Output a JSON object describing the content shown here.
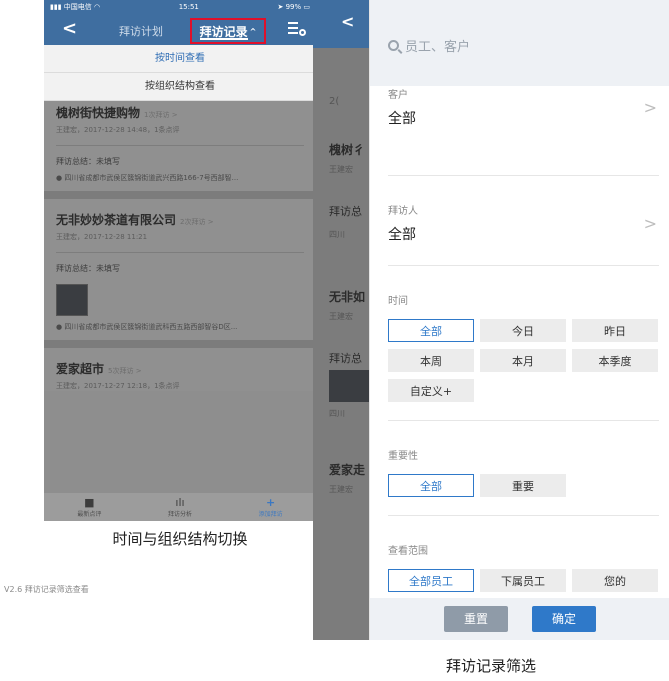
{
  "left_phone": {
    "status": {
      "carrier": "中国电信",
      "time": "15:51",
      "battery": "99%"
    },
    "nav": {
      "tab_plan": "拜访计划",
      "tab_record": "拜访记录"
    },
    "dropdown": [
      "按时间查看",
      "按组织结构查看"
    ],
    "cards": [
      {
        "title": "槐树街快捷购物",
        "count": "1次拜访 >",
        "meta": "王建宏，2017-12-28 14:48，1条点评",
        "summary": "拜访总结：未填写",
        "location": "四川省成都市武侯区簇锦街道武兴西路166-7号西部智..."
      },
      {
        "title": "无非妙妙茶道有限公司",
        "count": "2次拜访 >",
        "meta": "王建宏，2017-12-28 11:21",
        "summary": "拜访总结：未填写",
        "location": "四川省成都市武侯区簇锦街道武科西五路西部智谷D区..."
      },
      {
        "title": "爱家超市",
        "count": "5次拜访 >",
        "meta": "王建宏，2017-12-27 12:18，1条点评"
      }
    ],
    "tabbar": [
      "最新点评",
      "拜访分析",
      "添加拜访"
    ]
  },
  "caption_left": "时间与组织结构切换",
  "version_note": "V2.6 拜访记录筛选查看",
  "right_bg": {
    "nav_back": "<",
    "fragments": [
      "2(",
      "槐树彳",
      "王建宏",
      "拜访总",
      "四川",
      "无非如",
      "王建宏",
      "拜访总",
      "四川",
      "爱家走",
      "王建宏"
    ]
  },
  "filter_panel": {
    "search_placeholder": "员工、客户",
    "customer": {
      "label": "客户",
      "value": "全部"
    },
    "visitor": {
      "label": "拜访人",
      "value": "全部"
    },
    "time": {
      "label": "时间",
      "options": [
        "全部",
        "今日",
        "昨日",
        "本周",
        "本月",
        "本季度",
        "自定义+"
      ],
      "selected": "全部"
    },
    "importance": {
      "label": "重要性",
      "options": [
        "全部",
        "重要"
      ],
      "selected": "全部"
    },
    "scope": {
      "label": "查看范围",
      "options": [
        "全部员工",
        "下属员工",
        "您的"
      ],
      "selected": "全部员工"
    },
    "reset_label": "重置",
    "confirm_label": "确定"
  },
  "caption_right": "拜访记录筛选",
  "colors": {
    "accent": "#2f79c9",
    "navbar": "#3f6ea0",
    "highlight_box": "#e0102a"
  }
}
